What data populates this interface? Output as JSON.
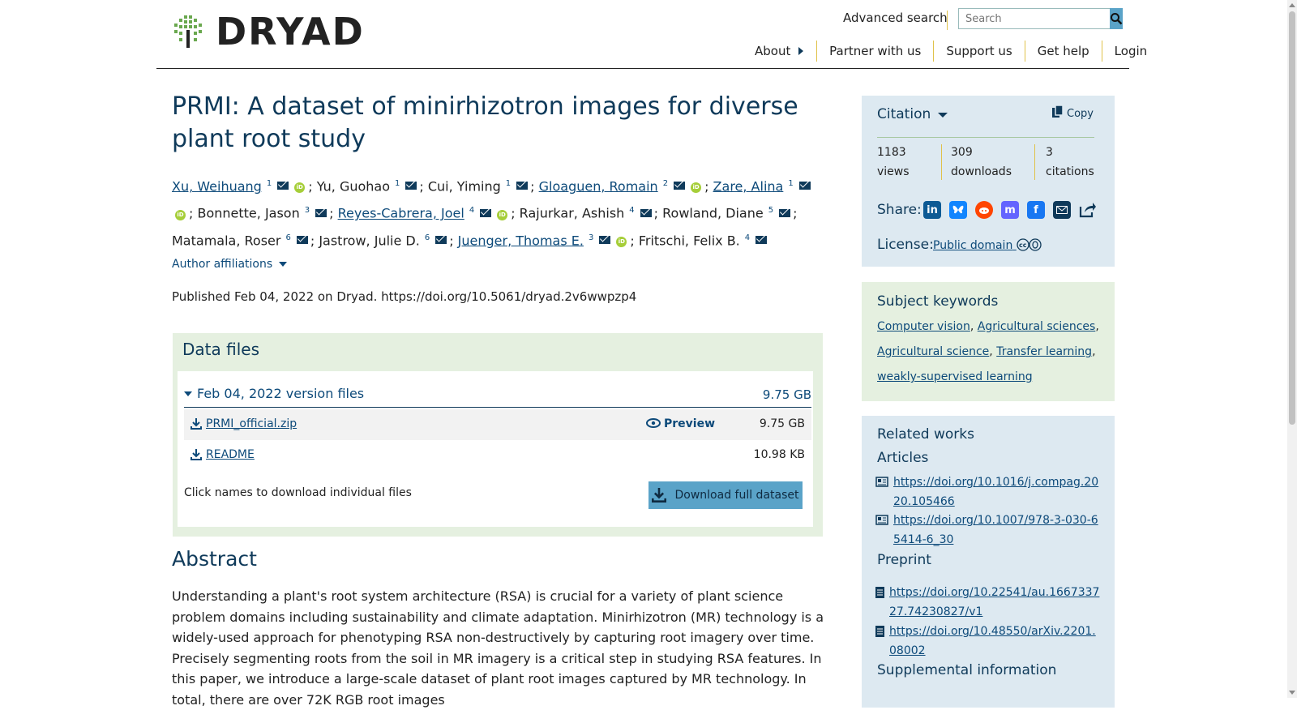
{
  "header": {
    "logo_text": "DRYAD",
    "advanced_search": "Advanced search",
    "search_placeholder": "Search",
    "nav": [
      "About",
      "Partner with us",
      "Support us",
      "Get help",
      "Login"
    ]
  },
  "dataset": {
    "title": "PRMI: A dataset of minirhizotron images for diverse plant root study",
    "authors": [
      {
        "name": "Xu, Weihuang",
        "aff": "1",
        "linked": true,
        "orcid": true
      },
      {
        "name": "Yu, Guohao",
        "aff": "1",
        "linked": false,
        "orcid": false
      },
      {
        "name": "Cui, Yiming",
        "aff": "1",
        "linked": false,
        "orcid": false
      },
      {
        "name": "Gloaguen, Romain",
        "aff": "2",
        "linked": true,
        "orcid": true
      },
      {
        "name": "Zare, Alina",
        "aff": "1",
        "linked": true,
        "orcid": true
      },
      {
        "name": "Bonnette, Jason",
        "aff": "3",
        "linked": false,
        "orcid": false
      },
      {
        "name": "Reyes-Cabrera, Joel",
        "aff": "4",
        "linked": true,
        "orcid": true
      },
      {
        "name": "Rajurkar, Ashish",
        "aff": "4",
        "linked": false,
        "orcid": false
      },
      {
        "name": "Rowland, Diane",
        "aff": "5",
        "linked": false,
        "orcid": false
      },
      {
        "name": "Matamala, Roser",
        "aff": "6",
        "linked": false,
        "orcid": false
      },
      {
        "name": "Jastrow, Julie D.",
        "aff": "6",
        "linked": false,
        "orcid": false
      },
      {
        "name": "Juenger, Thomas E.",
        "aff": "3",
        "linked": true,
        "orcid": true
      },
      {
        "name": "Fritschi, Felix B.",
        "aff": "4",
        "linked": false,
        "orcid": false
      }
    ],
    "author_affiliations": "Author affiliations",
    "published": "Published Feb 04, 2022 on Dryad. https://doi.org/10.5061/dryad.2v6wwpzp4"
  },
  "data_files": {
    "heading": "Data files",
    "version_label": "Feb 04, 2022 version files",
    "version_size": "9.75 GB",
    "files": [
      {
        "name": "PRMI_official.zip",
        "size": "9.75 GB",
        "preview": "Preview"
      },
      {
        "name": "README",
        "size": "10.98 KB"
      }
    ],
    "note": "Click names to download individual files",
    "download_full": "Download full dataset"
  },
  "abstract": {
    "heading": "Abstract",
    "text": "Understanding a plant's root system architecture (RSA) is crucial for a variety of plant science problem domains including sustainability and climate adaptation. Minirhizotron (MR) technology is a widely-used approach for phenotyping RSA non-destructively by capturing root imagery over time. Precisely segmenting roots from the soil in MR imagery is a critical step in studying RSA features. In this paper, we introduce a large-scale dataset of plant root images captured by MR technology. In total, there are over 72K RGB root images"
  },
  "sidebar": {
    "citation": {
      "heading": "Citation",
      "copy": "Copy",
      "stats": [
        {
          "value": "1183",
          "label": "views"
        },
        {
          "value": "309",
          "label": "downloads"
        },
        {
          "value": "3",
          "label": "citations"
        }
      ],
      "share_label": "Share:",
      "license_label": "License:",
      "license_value": "Public domain"
    },
    "keywords": {
      "heading": "Subject keywords",
      "items": [
        "Computer vision",
        "Agricultural sciences",
        "Agricultural science",
        "Transfer learning",
        "weakly-supervised learning"
      ]
    },
    "related": {
      "heading": "Related works",
      "articles_label": "Articles",
      "articles": [
        "https://doi.org/10.1016/j.compag.2020.105466",
        "https://doi.org/10.1007/978-3-030-65414-6_30"
      ],
      "preprint_label": "Preprint",
      "preprints": [
        "https://doi.org/10.22541/au.166733727.74230827/v1",
        "https://doi.org/10.48550/arXiv.2201.08002"
      ],
      "supplemental_label": "Supplemental information"
    }
  }
}
